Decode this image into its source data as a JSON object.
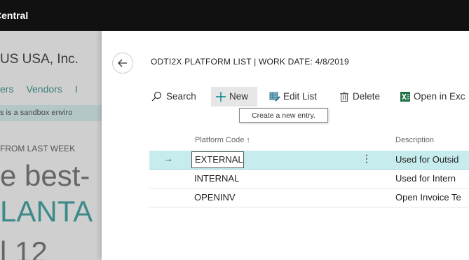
{
  "app": {
    "title": "Central"
  },
  "background_page": {
    "company": "US USA, Inc.",
    "nav": [
      "ers",
      "Vendors",
      "I"
    ],
    "sandbox_notice": "s is a sandbox enviro",
    "headline_label": "FROM LAST WEEK",
    "big_lines": [
      "e best-",
      "LANTA",
      "l 12"
    ]
  },
  "panel": {
    "title": "ODTI2X PLATFORM LIST | WORK DATE: 4/8/2019",
    "toolbar": {
      "search": "Search",
      "new": "New",
      "edit_list": "Edit List",
      "delete": "Delete",
      "open_in_excel": "Open in Exc"
    },
    "tooltip": "Create a new entry.",
    "columns": {
      "code": "Platform Code ↑",
      "description": "Description"
    },
    "rows": [
      {
        "code": "EXTERNAL",
        "description": "Used for Outsid",
        "selected": true
      },
      {
        "code": "INTERNAL",
        "description": "Used for Intern",
        "selected": false
      },
      {
        "code": "OPENINV",
        "description": "Open Invoice Te",
        "selected": false
      }
    ]
  },
  "icons": {
    "back": "arrow-left-icon",
    "search": "search-icon",
    "new": "plus-icon",
    "edit_list": "edit-list-icon",
    "delete": "trash-icon",
    "excel": "excel-icon",
    "row_pointer": "arrow-right-icon",
    "row_menu": "more-vertical-icon"
  },
  "colors": {
    "topbar": "#111111",
    "accent": "#008489",
    "selected_row": "#c7ecee",
    "excel_green": "#1e7145"
  }
}
